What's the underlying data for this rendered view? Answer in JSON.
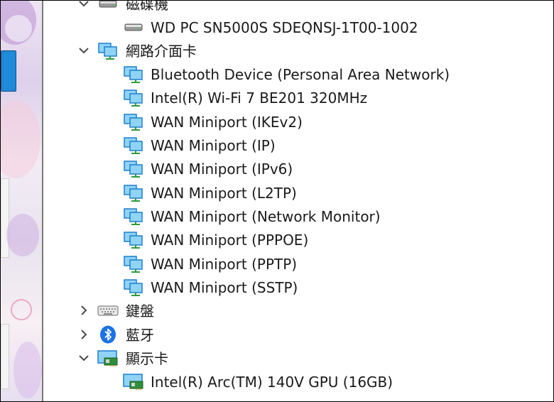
{
  "categories": {
    "disk": {
      "label": "磁碟機",
      "expanded": true,
      "icon": "disk-drive-icon",
      "children": [
        {
          "label": "WD PC SN5000S SDEQNSJ-1T00-1002",
          "icon": "disk-drive-icon"
        }
      ]
    },
    "network": {
      "label": "網路介面卡",
      "expanded": true,
      "icon": "network-adapter-icon",
      "children": [
        {
          "label": "Bluetooth Device (Personal Area Network)",
          "icon": "network-adapter-icon"
        },
        {
          "label": "Intel(R) Wi-Fi 7 BE201 320MHz",
          "icon": "network-adapter-icon"
        },
        {
          "label": "WAN Miniport (IKEv2)",
          "icon": "network-adapter-icon"
        },
        {
          "label": "WAN Miniport (IP)",
          "icon": "network-adapter-icon"
        },
        {
          "label": "WAN Miniport (IPv6)",
          "icon": "network-adapter-icon"
        },
        {
          "label": "WAN Miniport (L2TP)",
          "icon": "network-adapter-icon"
        },
        {
          "label": "WAN Miniport (Network Monitor)",
          "icon": "network-adapter-icon"
        },
        {
          "label": "WAN Miniport (PPPOE)",
          "icon": "network-adapter-icon"
        },
        {
          "label": "WAN Miniport (PPTP)",
          "icon": "network-adapter-icon"
        },
        {
          "label": "WAN Miniport (SSTP)",
          "icon": "network-adapter-icon"
        }
      ]
    },
    "keyboard": {
      "label": "鍵盤",
      "expanded": false,
      "icon": "keyboard-icon"
    },
    "bluetooth": {
      "label": "藍牙",
      "expanded": false,
      "icon": "bluetooth-icon"
    },
    "display": {
      "label": "顯示卡",
      "expanded": true,
      "icon": "display-adapter-icon",
      "children": [
        {
          "label": "Intel(R) Arc(TM) 140V GPU (16GB)",
          "icon": "display-adapter-icon"
        }
      ]
    }
  },
  "colors": {
    "network_icon": "#1e7fd0",
    "network_screen": "#8fd3f5",
    "network_cable": "#2e9a3b",
    "bluetooth": "#1a73e8",
    "display_board": "#2f8f3a",
    "chevron": "#4a4a4a"
  }
}
